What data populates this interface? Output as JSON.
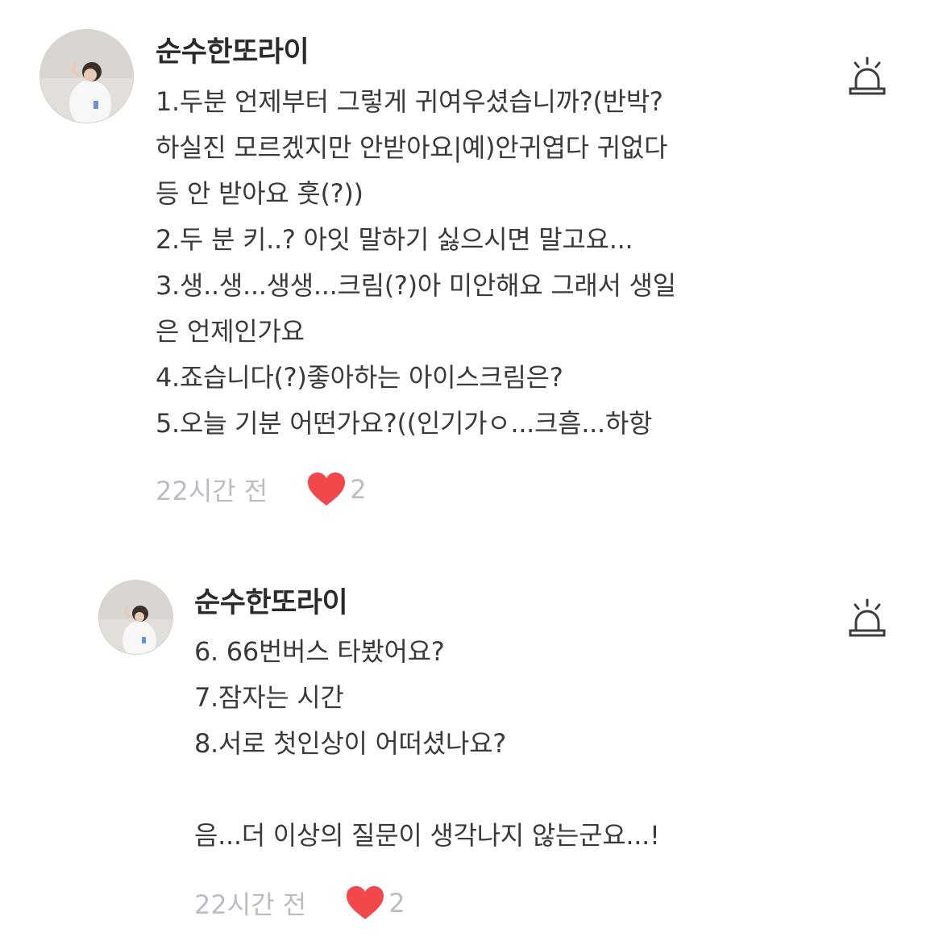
{
  "comments": [
    {
      "author": "순수한또라이",
      "lines": [
        "1.두분 언제부터 그렇게 귀여우셨습니까?(반박?",
        "하실진 모르겠지만 안받아요|예)안귀엽다 귀없다",
        "등 안 받아요 훗(?))",
        "2.두 분 키..? 아잇 말하기 싫으시면 말고요...",
        "3.생..생...생생...크림(?)아 미안해요 그래서 생일",
        "은 언제인가요",
        "4.죠습니다(?)좋아하는 아이스크림은?",
        "5.오늘 기분 어떤가요?((인기가ㅇ...크흠...하항"
      ],
      "time": "22시간 전",
      "likes": "2",
      "avatar_icon": "user-photo-avatar",
      "report_icon": "siren-report-icon"
    },
    {
      "author": "순수한또라이",
      "lines": [
        "6. 66번버스 타봤어요?",
        "7.잠자는 시간",
        "8.서로 첫인상이 어떠셨나요?",
        "",
        "음...더 이상의 질문이 생각나지 않는군요...!"
      ],
      "time": "22시간 전",
      "likes": "2",
      "avatar_icon": "user-photo-avatar",
      "report_icon": "siren-report-icon"
    }
  ],
  "colors": {
    "heart": "#f2484b",
    "meta_text": "#b9bec6",
    "body_text": "#3a3a3a",
    "author_text": "#2a2a2a",
    "icon_stroke": "#3d3d3d"
  }
}
